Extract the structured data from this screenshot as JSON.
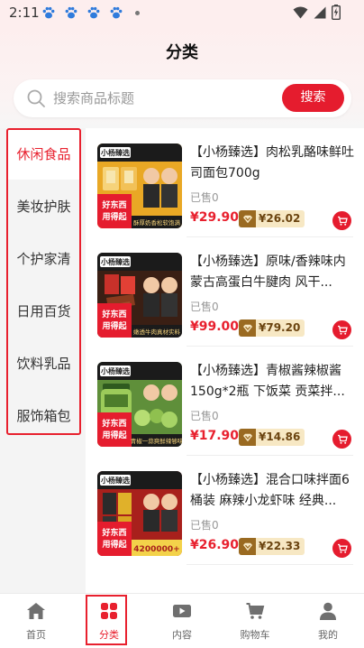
{
  "status_bar": {
    "time": "2:11"
  },
  "header": {
    "title": "分类"
  },
  "search": {
    "placeholder": "搜索商品标题",
    "button_label": "搜索"
  },
  "sidebar": {
    "categories": [
      {
        "label": "休闲食品",
        "active": true
      },
      {
        "label": "美妆护肤",
        "active": false
      },
      {
        "label": "个护家清",
        "active": false
      },
      {
        "label": "日用百货",
        "active": false
      },
      {
        "label": "饮料乳品",
        "active": false
      },
      {
        "label": "服饰箱包",
        "active": false
      }
    ]
  },
  "products": [
    {
      "title": "【小杨臻选】肉松乳酪味鲜吐司面包700g",
      "sold": "已售0",
      "price": "¥29.90",
      "vip_price": "¥26.02",
      "thumb": {
        "brand": "小杨臻选",
        "badge_line1": "好东西",
        "badge_line2": "用得起",
        "caption": "酥厚奶香松软饱满"
      }
    },
    {
      "title": "【小杨臻选】原味/香辣味内蒙古高蛋白牛腱肉 风干...",
      "sold": "已售0",
      "price": "¥99.00",
      "vip_price": "¥79.20",
      "thumb": {
        "brand": "小杨臻选",
        "badge_line1": "好东西",
        "badge_line2": "用得起",
        "caption": "嫩透牛肉真材实料"
      }
    },
    {
      "title": "【小杨臻选】青椒酱辣椒酱150g*2瓶 下饭菜 贡菜拌...",
      "sold": "已售0",
      "price": "¥17.90",
      "vip_price": "¥14.86",
      "thumb": {
        "brand": "小杨臻选",
        "badge_line1": "好东西",
        "badge_line2": "用得起",
        "caption": "青椒一蒜爽鲜辣够味"
      }
    },
    {
      "title": "【小杨臻选】混合口味拌面6桶装 麻辣小龙虾味 经典...",
      "sold": "已售0",
      "price": "¥26.90",
      "vip_price": "¥22.33",
      "thumb": {
        "brand": "小杨臻选",
        "badge_line1": "好东西",
        "badge_line2": "用得起",
        "caption": "4200000+"
      }
    }
  ],
  "tabbar": {
    "tabs": [
      {
        "label": "首页",
        "icon": "home-icon",
        "active": false
      },
      {
        "label": "分类",
        "icon": "category-grid-icon",
        "active": true
      },
      {
        "label": "内容",
        "icon": "video-play-icon",
        "active": false
      },
      {
        "label": "购物车",
        "icon": "cart-icon",
        "active": false
      },
      {
        "label": "我的",
        "icon": "person-icon",
        "active": false
      }
    ]
  },
  "colors": {
    "accent": "#e51c2e",
    "vip_gold": "#f7e8c4",
    "vip_badge": "#9a6a21"
  }
}
